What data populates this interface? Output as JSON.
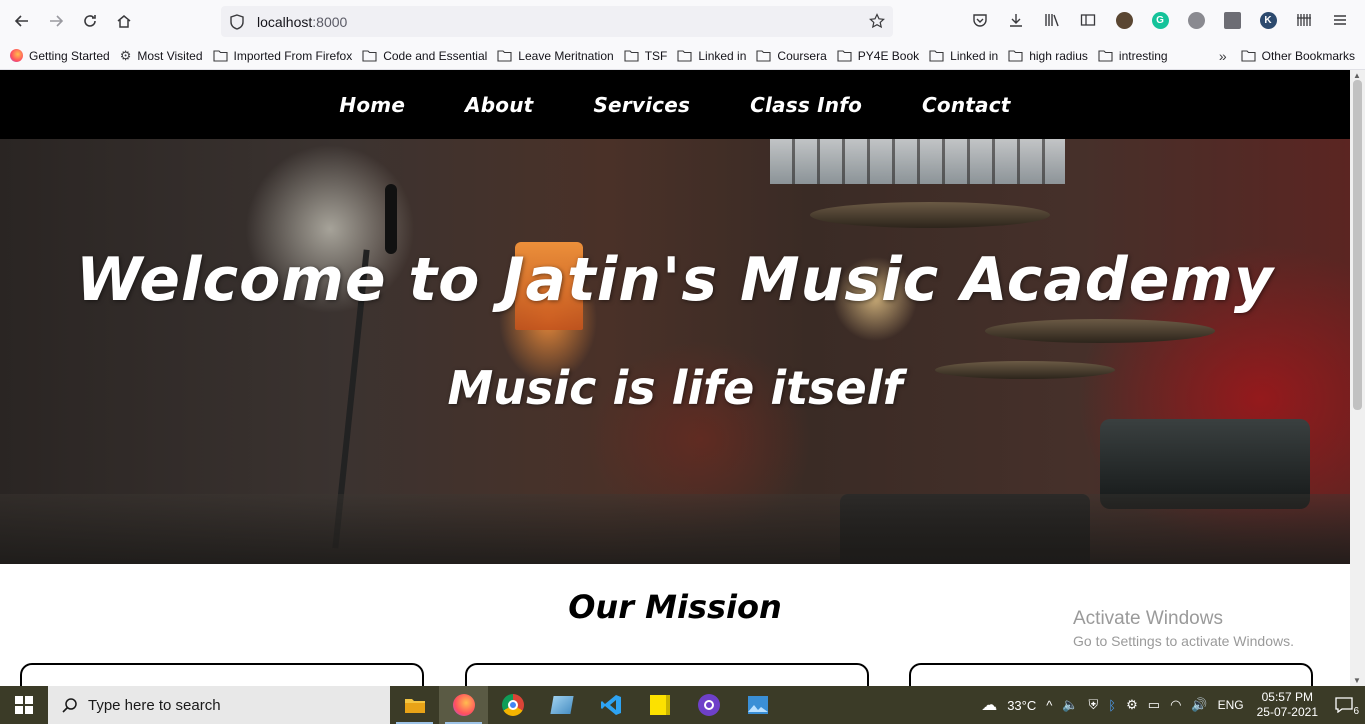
{
  "browser": {
    "url_host": "localhost",
    "url_port": ":8000",
    "bookmarks": [
      {
        "label": "Getting Started",
        "icon": "firefox-icon"
      },
      {
        "label": "Most Visited",
        "icon": "gear-icon"
      },
      {
        "label": "Imported From Firefox",
        "icon": "folder-icon"
      },
      {
        "label": "Code and Essential",
        "icon": "folder-icon"
      },
      {
        "label": "Leave Meritnation",
        "icon": "folder-icon"
      },
      {
        "label": "TSF",
        "icon": "folder-icon"
      },
      {
        "label": "Linked in",
        "icon": "folder-icon"
      },
      {
        "label": "Coursera",
        "icon": "folder-icon"
      },
      {
        "label": "PY4E Book",
        "icon": "folder-icon"
      },
      {
        "label": "Linked in",
        "icon": "folder-icon"
      },
      {
        "label": "high radius",
        "icon": "folder-icon"
      },
      {
        "label": "intresting",
        "icon": "folder-icon"
      }
    ],
    "other_bookmarks": "Other Bookmarks"
  },
  "site": {
    "nav": [
      "Home",
      "About",
      "Services",
      "Class Info",
      "Contact"
    ],
    "hero_title": "Welcome to Jatin's Music Academy",
    "hero_subtitle": "Music is life itself",
    "mission_title": "Our Mission"
  },
  "watermark": {
    "line1": "Activate Windows",
    "line2": "Go to Settings to activate Windows."
  },
  "taskbar": {
    "search_placeholder": "Type here to search",
    "temperature": "33°C",
    "language": "ENG",
    "time": "05:57 PM",
    "date": "25-07-2021",
    "notification_count": "6"
  },
  "colors": {
    "nav_bg": "#000000",
    "taskbar_bg": "#3b3b27"
  }
}
